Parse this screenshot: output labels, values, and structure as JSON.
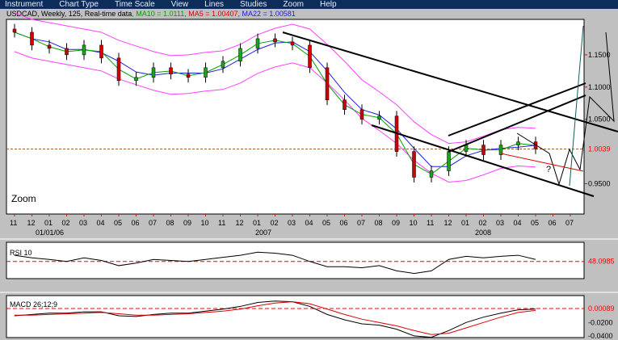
{
  "menu": [
    "Instrument",
    "Chart Type",
    "Time Scale",
    "View",
    "Lines",
    "Studies",
    "Zoom",
    "Help"
  ],
  "info": {
    "symbol": "USDCAD",
    "rest": ", Weekly, 125, Real-time data",
    "ma10": ", MA10 = 1.0111",
    "ma5": ", MA5 = 1.00407",
    "ma22": ", MA22 = 1.00581"
  },
  "colors": {
    "ma10": "#00a000",
    "ma5": "#e00000",
    "ma22": "#2020e0",
    "bands": "#ff40ff",
    "ref": "#ff0000"
  },
  "zoom_label": "Zoom",
  "chart_data": [
    {
      "type": "candlestick",
      "title": "USDCAD Weekly",
      "x": [
        "11",
        "12",
        "01",
        "02",
        "03",
        "04",
        "05",
        "06",
        "07",
        "08",
        "09",
        "10",
        "11",
        "12",
        "01",
        "02",
        "03",
        "04",
        "05",
        "06",
        "07",
        "08",
        "09",
        "10",
        "11",
        "12",
        "01",
        "02",
        "03",
        "04",
        "05"
      ],
      "year_labels": [
        "01/01/06",
        "2007",
        "2008"
      ],
      "x_ticks": [
        "11",
        "12",
        "01",
        "02",
        "03",
        "04",
        "05",
        "06",
        "07",
        "08",
        "09",
        "10",
        "11",
        "12",
        "01",
        "02",
        "03",
        "04",
        "05",
        "06",
        "07",
        "08",
        "09",
        "10",
        "11",
        "12",
        "01",
        "02",
        "03",
        "04",
        "05",
        "06",
        "07"
      ],
      "close": [
        1.185,
        1.165,
        1.16,
        1.15,
        1.165,
        1.145,
        1.11,
        1.115,
        1.13,
        1.12,
        1.115,
        1.13,
        1.14,
        1.16,
        1.175,
        1.17,
        1.165,
        1.13,
        1.08,
        1.065,
        1.05,
        1.055,
        1.0,
        0.96,
        0.97,
        1.0,
        1.01,
        0.995,
        1.01,
        1.015,
        1.004
      ],
      "ylim": [
        0.903,
        1.205
      ],
      "y_ticks": [
        "1.1500",
        "1.1000",
        "1.0500",
        "0.9500"
      ],
      "ref_line": {
        "value": 1.0039,
        "label": "1.0039"
      },
      "annotations": [
        "?"
      ]
    },
    {
      "type": "line",
      "title": "RSI 10",
      "ref_line": {
        "value": 48.0985,
        "label": "48.0985"
      },
      "values": [
        60,
        55,
        52,
        48,
        55,
        50,
        40,
        45,
        52,
        50,
        48,
        52,
        56,
        60,
        66,
        64,
        60,
        48,
        38,
        38,
        36,
        40,
        30,
        25,
        30,
        52,
        58,
        55,
        58,
        60,
        52
      ]
    },
    {
      "type": "line",
      "title": "MACD 26;12;9",
      "ref_line": {
        "value": 0.00089,
        "label": "0.00089"
      },
      "y_ticks": [
        "-0.0200",
        "-0.0400"
      ],
      "macd": [
        -0.01,
        -0.008,
        -0.006,
        -0.006,
        -0.004,
        -0.004,
        -0.01,
        -0.011,
        -0.008,
        -0.006,
        -0.006,
        -0.003,
        0.0,
        0.004,
        0.01,
        0.012,
        0.011,
        0.004,
        -0.008,
        -0.016,
        -0.022,
        -0.024,
        -0.03,
        -0.04,
        -0.042,
        -0.032,
        -0.02,
        -0.012,
        -0.006,
        -0.001,
        0.0
      ],
      "signal": [
        -0.009,
        -0.009,
        -0.008,
        -0.007,
        -0.006,
        -0.005,
        -0.007,
        -0.009,
        -0.009,
        -0.008,
        -0.007,
        -0.005,
        -0.003,
        0.0,
        0.005,
        0.009,
        0.011,
        0.008,
        0.0,
        -0.008,
        -0.015,
        -0.02,
        -0.025,
        -0.032,
        -0.038,
        -0.036,
        -0.028,
        -0.02,
        -0.012,
        -0.005,
        -0.002
      ]
    }
  ]
}
